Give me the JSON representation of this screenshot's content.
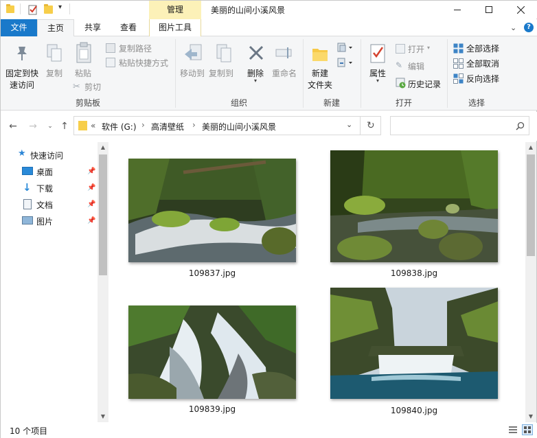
{
  "quick_access_toolbar": {
    "items": [
      "folder-icon",
      "properties-check-icon",
      "new-folder-icon",
      "customize-arrow-icon"
    ]
  },
  "context_tab": {
    "label": "管理"
  },
  "window": {
    "title": "美丽的山间小溪风景",
    "minimize_icon": "minimize-icon",
    "maximize_icon": "maximize-icon",
    "close_icon": "close-icon"
  },
  "tabs": [
    {
      "label": "文件"
    },
    {
      "label": "主页"
    },
    {
      "label": "共享"
    },
    {
      "label": "查看"
    },
    {
      "label": "图片工具"
    }
  ],
  "ribbon_controls": {
    "collapse_icon": "chevron-down-icon",
    "help_icon": "help-icon"
  },
  "ribbon": {
    "clipboard": {
      "label": "剪贴板",
      "pin_quick_access": "固定到快\n速访问",
      "pin_line1": "固定到快",
      "pin_line2": "速访问",
      "copy": "复制",
      "paste": "粘贴",
      "copy_path": "复制路径",
      "paste_shortcut": "粘贴快捷方式",
      "cut": "剪切"
    },
    "organize": {
      "label": "组织",
      "move_to": "移动到",
      "copy_to": "复制到",
      "delete": "删除",
      "rename": "重命名"
    },
    "new": {
      "label": "新建",
      "new_folder_line1": "新建",
      "new_folder_line2": "文件夹"
    },
    "open": {
      "label": "打开",
      "properties": "属性",
      "open": "打开",
      "edit": "编辑",
      "history": "历史记录"
    },
    "select": {
      "label": "选择",
      "select_all": "全部选择",
      "select_none": "全部取消",
      "invert": "反向选择"
    }
  },
  "address": {
    "prefix": "«",
    "crumbs": [
      "软件 (G:)",
      "高清壁纸",
      "美丽的山间小溪风景"
    ],
    "separator": "›"
  },
  "search": {
    "placeholder": "",
    "icon": "search-icon"
  },
  "nav_pane": {
    "quick_access": "快速访问",
    "items": [
      {
        "label": "桌面",
        "icon": "desktop-icon"
      },
      {
        "label": "下载",
        "icon": "download-icon"
      },
      {
        "label": "文档",
        "icon": "documents-icon"
      },
      {
        "label": "图片",
        "icon": "pictures-icon"
      }
    ]
  },
  "files": [
    {
      "name": "109837.jpg"
    },
    {
      "name": "109838.jpg"
    },
    {
      "name": "109839.jpg"
    },
    {
      "name": "109840.jpg"
    }
  ],
  "status": {
    "count": "10 个项目"
  },
  "colors": {
    "accent": "#1979ca",
    "context_tab": "#fcf1b8",
    "ribbon_bg": "#f5f6f7"
  }
}
